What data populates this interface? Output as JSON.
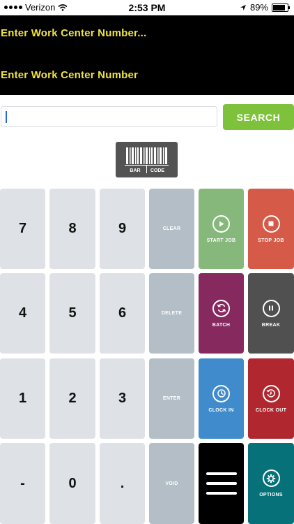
{
  "status": {
    "carrier": "Verizon",
    "time": "2:53 PM",
    "battery": "89%"
  },
  "header": {
    "line1": "Enter Work Center Number...",
    "line2": "Enter Work Center Number"
  },
  "search": {
    "value": "",
    "placeholder": "",
    "button_label": "SEARCH"
  },
  "barcode": {
    "label_top": "BAR",
    "label_bottom": "CODE",
    "icon": "barcode-icon"
  },
  "keypad": {
    "digits": [
      "7",
      "8",
      "9",
      "4",
      "5",
      "6",
      "1",
      "2",
      "3",
      "-",
      "0",
      "."
    ],
    "actions": [
      "CLEAR",
      "DELETE",
      "ENTER",
      "VOID"
    ]
  },
  "functions": {
    "start_job": "START JOB",
    "stop_job": "STOP JOB",
    "batch": "BATCH",
    "break": "BREAK",
    "clock_in": "CLOCK IN",
    "clock_out": "CLOCK OUT",
    "options": "OPTIONS"
  },
  "colors": {
    "header_bg": "#000000",
    "header_text": "#f0e441",
    "search_button": "#7dc23a",
    "start_job": "#86b87c",
    "stop_job": "#d65a48",
    "batch": "#86295f",
    "break": "#505050",
    "clock_in": "#3f8bcb",
    "clock_out": "#b0272f",
    "menu": "#000000",
    "options": "#07717a"
  }
}
